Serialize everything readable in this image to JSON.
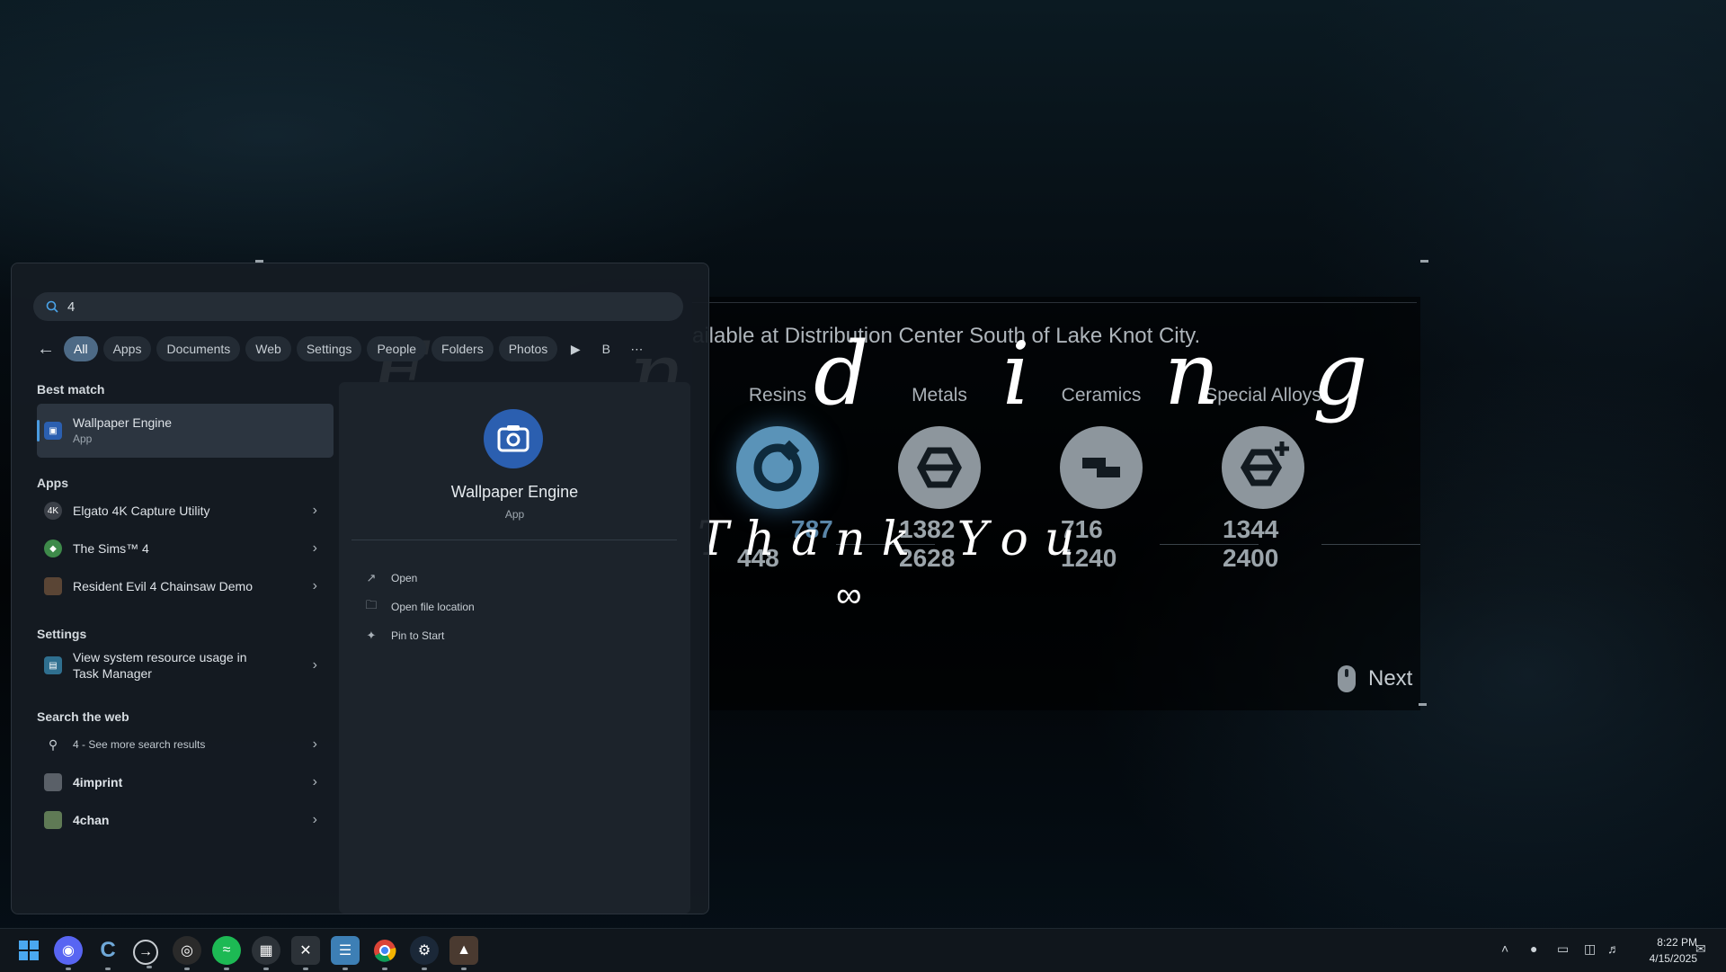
{
  "game": {
    "notice": "ailable at Distribution Center South of Lake Knot City.",
    "materials": [
      {
        "label": "Resins",
        "values": [
          "787",
          "448"
        ]
      },
      {
        "label": "Metals",
        "values": [
          "1382",
          "2628"
        ]
      },
      {
        "label": "Ceramics",
        "values": [
          "716",
          "1240"
        ]
      },
      {
        "label": "Special Alloys",
        "values": [
          "1344",
          "2400"
        ]
      }
    ],
    "next_label": "Next",
    "overlay": {
      "ending_letters": [
        "E",
        "n",
        "d",
        "i",
        "n",
        "g"
      ],
      "thank_you": "Thank You",
      "infinity": "∞"
    }
  },
  "search": {
    "query": "4",
    "filters": [
      "All",
      "Apps",
      "Documents",
      "Web",
      "Settings",
      "People",
      "Folders",
      "Photos"
    ],
    "active_filter": "All",
    "extra_chip": "B",
    "sections": {
      "best_match": "Best match",
      "apps": "Apps",
      "settings": "Settings",
      "web": "Search the web"
    },
    "best_match": {
      "title": "Wallpaper Engine",
      "subtitle": "App"
    },
    "apps": [
      {
        "label": "Elgato 4K Capture Utility",
        "icon": "elgato-icon"
      },
      {
        "label": "The Sims™ 4",
        "icon": "sims-icon"
      },
      {
        "label": "Resident Evil 4 Chainsaw Demo",
        "icon": "re4-icon"
      }
    ],
    "settings": [
      {
        "label_line1": "View system resource usage in",
        "label_line2": "Task Manager"
      }
    ],
    "web": [
      {
        "label": "4 - See more search results",
        "icon": "search-icon"
      },
      {
        "label": "4imprint",
        "icon": "site-icon"
      },
      {
        "label": "4chan",
        "icon": "site-icon"
      }
    ],
    "preview": {
      "title": "Wallpaper Engine",
      "subtitle": "App",
      "actions": [
        "Open",
        "Open file location",
        "Pin to Start"
      ]
    }
  },
  "taskbar": {
    "apps": [
      "windows-start-icon",
      "discord-icon",
      "ccleaner-icon",
      "arrow-app-icon",
      "obs-icon",
      "spotify-icon",
      "keyboard-app-icon",
      "capcut-icon",
      "notepad-icon",
      "chrome-icon",
      "steam-icon",
      "game-icon"
    ],
    "time": "8:22 PM",
    "date": "4/15/2025"
  },
  "colors": {
    "accent": "#4d6a86",
    "panel": "#161c24"
  }
}
